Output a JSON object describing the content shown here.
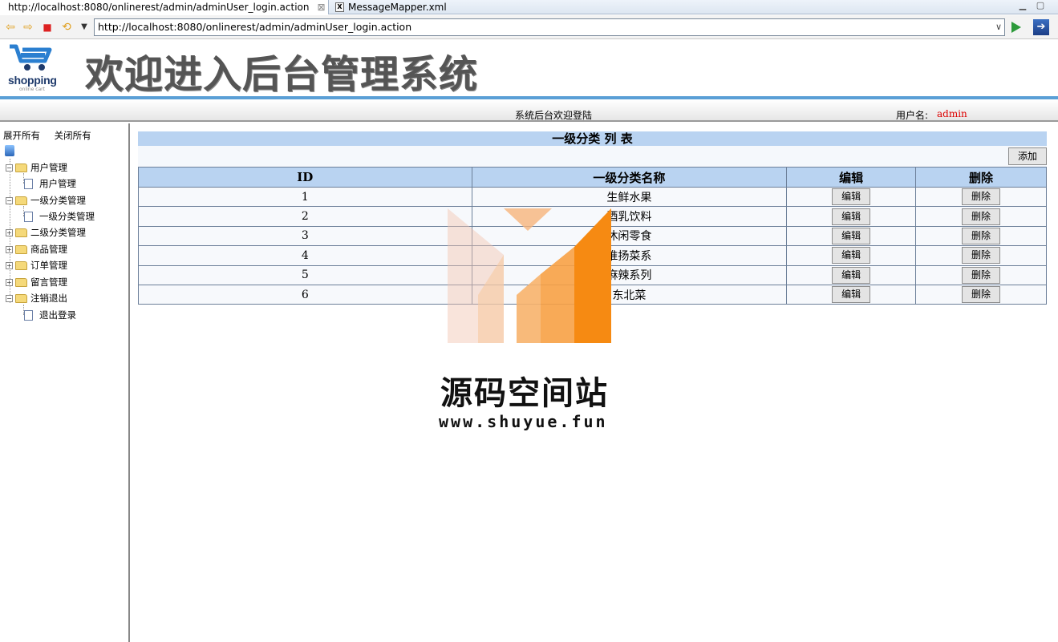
{
  "browser": {
    "active_tab": "http://localhost:8080/onlinerest/admin/adminUser_login.action",
    "inactive_tab": "MessageMapper.xml",
    "url": "http://localhost:8080/onlinerest/admin/adminUser_login.action"
  },
  "header": {
    "logo_text": "shopping",
    "logo_subtext": "online cart",
    "title": "欢迎进入后台管理系统",
    "welcome": "系统后台欢迎登陆",
    "user_label": "用户名:",
    "user_name": "admin"
  },
  "sidebar": {
    "expand_all": "展开所有",
    "collapse_all": "关闭所有",
    "nodes": [
      {
        "label": "用户管理",
        "expander": "−"
      },
      {
        "label": "用户管理"
      },
      {
        "label": "一级分类管理",
        "expander": "−"
      },
      {
        "label": "一级分类管理"
      },
      {
        "label": "二级分类管理",
        "expander": "+"
      },
      {
        "label": "商品管理",
        "expander": "+"
      },
      {
        "label": "订单管理",
        "expander": "+"
      },
      {
        "label": "留言管理",
        "expander": "+"
      },
      {
        "label": "注销退出",
        "expander": "−"
      },
      {
        "label": "退出登录"
      }
    ]
  },
  "main": {
    "list_title": "一级分类 列 表",
    "add_label": "添加",
    "columns": [
      "ID",
      "一级分类名称",
      "编辑",
      "删除"
    ],
    "edit_label": "编辑",
    "delete_label": "删除",
    "rows": [
      {
        "id": "1",
        "name": "生鲜水果"
      },
      {
        "id": "2",
        "name": "酒乳饮料"
      },
      {
        "id": "3",
        "name": "休闲零食"
      },
      {
        "id": "4",
        "name": "淮扬菜系"
      },
      {
        "id": "5",
        "name": "麻辣系列"
      },
      {
        "id": "6",
        "name": "东北菜"
      }
    ]
  },
  "watermark": {
    "name": "源码空间站",
    "url": "www.shuyue.fun"
  }
}
